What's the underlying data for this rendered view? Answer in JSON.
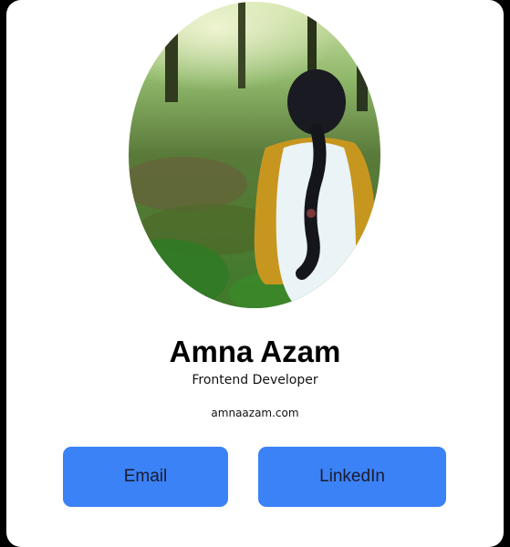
{
  "profile": {
    "name": "Amna Azam",
    "role": "Frontend Developer",
    "website": "amnaazam.com",
    "avatar_description": "profile-photo"
  },
  "actions": {
    "email_label": "Email",
    "linkedin_label": "LinkedIn"
  },
  "colors": {
    "page_background": "#000000",
    "card_background": "#ffffff",
    "button_background": "#3b82f6",
    "button_text": "#1b1b2e"
  }
}
